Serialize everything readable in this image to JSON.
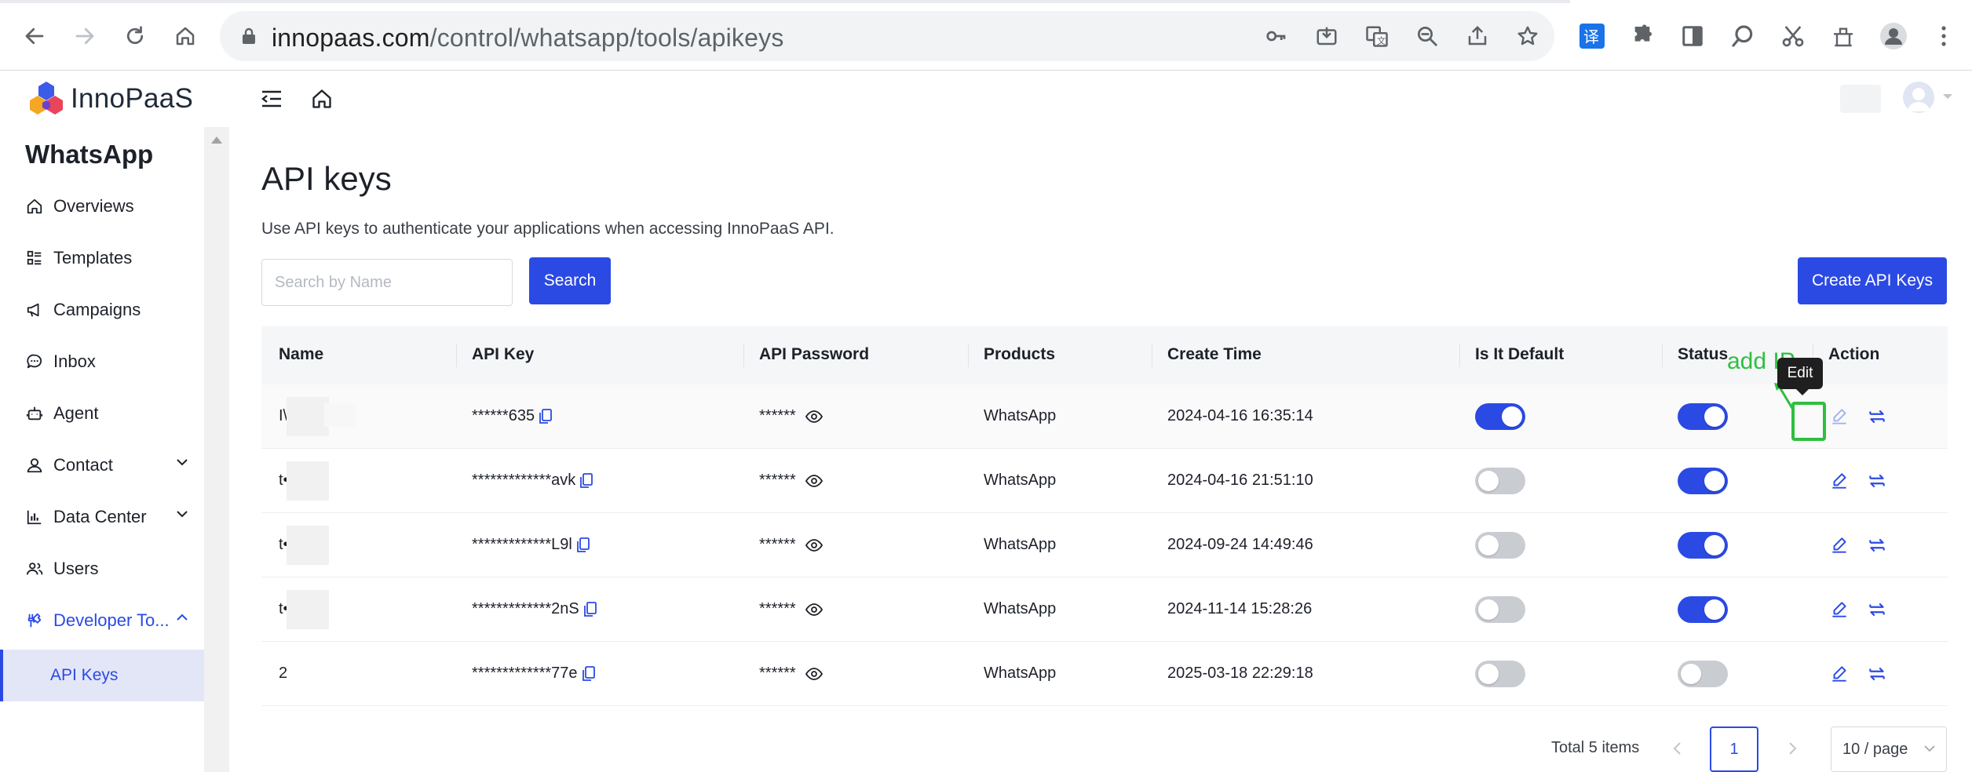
{
  "browser": {
    "url_host": "innopaas.com",
    "url_path": "/control/whatsapp/tools/apikeys"
  },
  "header": {
    "brand": "InnoPaaS"
  },
  "sidebar": {
    "title": "WhatsApp",
    "items": [
      {
        "label": "Overviews",
        "icon": "home-icon"
      },
      {
        "label": "Templates",
        "icon": "template-list-icon"
      },
      {
        "label": "Campaigns",
        "icon": "megaphone-icon"
      },
      {
        "label": "Inbox",
        "icon": "chat-bubble-icon"
      },
      {
        "label": "Agent",
        "icon": "robot-icon"
      },
      {
        "label": "Contact",
        "icon": "person-icon",
        "expandable": true
      },
      {
        "label": "Data Center",
        "icon": "bar-chart-icon",
        "expandable": true
      },
      {
        "label": "Users",
        "icon": "users-icon"
      },
      {
        "label": "Developer To...",
        "icon": "tools-icon",
        "expanded": true
      }
    ],
    "sub_item": "API Keys"
  },
  "page": {
    "title": "API keys",
    "description": "Use API keys to authenticate your applications when accessing InnoPaaS API.",
    "search_placeholder": "Search by Name",
    "search_button": "Search",
    "create_button": "Create API Keys"
  },
  "table": {
    "columns": [
      "Name",
      "API Key",
      "API Password",
      "Products",
      "Create Time",
      "Is It Default",
      "Status",
      "Action"
    ],
    "rows": [
      {
        "name": "I\\",
        "api_key": "******635",
        "api_password": "******",
        "product": "WhatsApp",
        "create_time": "2024-04-16 16:35:14",
        "is_default": true,
        "status": true
      },
      {
        "name": "t•",
        "api_key": "*************avk",
        "api_password": "******",
        "product": "WhatsApp",
        "create_time": "2024-04-16 21:51:10",
        "is_default": false,
        "status": true
      },
      {
        "name": "t•",
        "api_key": "*************L9l",
        "api_password": "******",
        "product": "WhatsApp",
        "create_time": "2024-09-24 14:49:46",
        "is_default": false,
        "status": true
      },
      {
        "name": "t•",
        "api_key": "*************2nS",
        "api_password": "******",
        "product": "WhatsApp",
        "create_time": "2024-11-14 15:28:26",
        "is_default": false,
        "status": true
      },
      {
        "name": "2",
        "api_key": "*************77e",
        "api_password": "******",
        "product": "WhatsApp",
        "create_time": "2025-03-18 22:29:18",
        "is_default": false,
        "status": false
      }
    ]
  },
  "annotation": {
    "text": "add IP",
    "tooltip": "Edit"
  },
  "pagination": {
    "total": "Total 5 items",
    "current_page": "1",
    "page_size": "10 / page"
  },
  "colors": {
    "accent": "#2b4ae4",
    "annotation": "#2fbf3f"
  }
}
